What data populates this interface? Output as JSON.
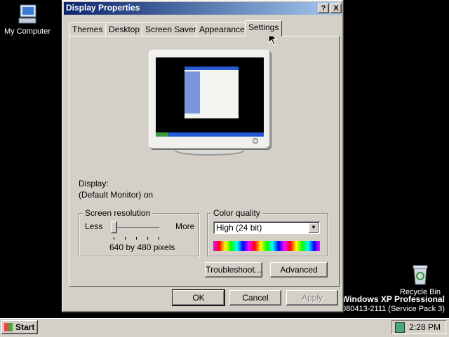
{
  "desktop": {
    "my_computer_label": "My Computer",
    "recycle_bin_label": "Recycle Bin",
    "watermark_line1": "Windows XP Professional",
    "watermark_line2": "080413-2111 (Service Pack 3)"
  },
  "window": {
    "title": "Display Properties",
    "help_glyph": "?",
    "close_glyph": "X",
    "tabs": [
      {
        "label": "Themes"
      },
      {
        "label": "Desktop"
      },
      {
        "label": "Screen Saver"
      },
      {
        "label": "Appearance"
      },
      {
        "label": "Settings",
        "active": true
      }
    ],
    "settings": {
      "display_label": "Display:",
      "display_value": "(Default Monitor) on",
      "resolution": {
        "group_label": "Screen resolution",
        "less_label": "Less",
        "more_label": "More",
        "value_text": "640 by 480 pixels",
        "slider_level": 0
      },
      "color_quality": {
        "group_label": "Color quality",
        "selected": "High (24 bit)"
      },
      "troubleshoot_label": "Troubleshoot...",
      "advanced_label": "Advanced"
    },
    "buttons": {
      "ok": "OK",
      "cancel": "Cancel",
      "apply": "Apply"
    }
  },
  "taskbar": {
    "start_label": "Start",
    "clock": "2:28 PM"
  }
}
